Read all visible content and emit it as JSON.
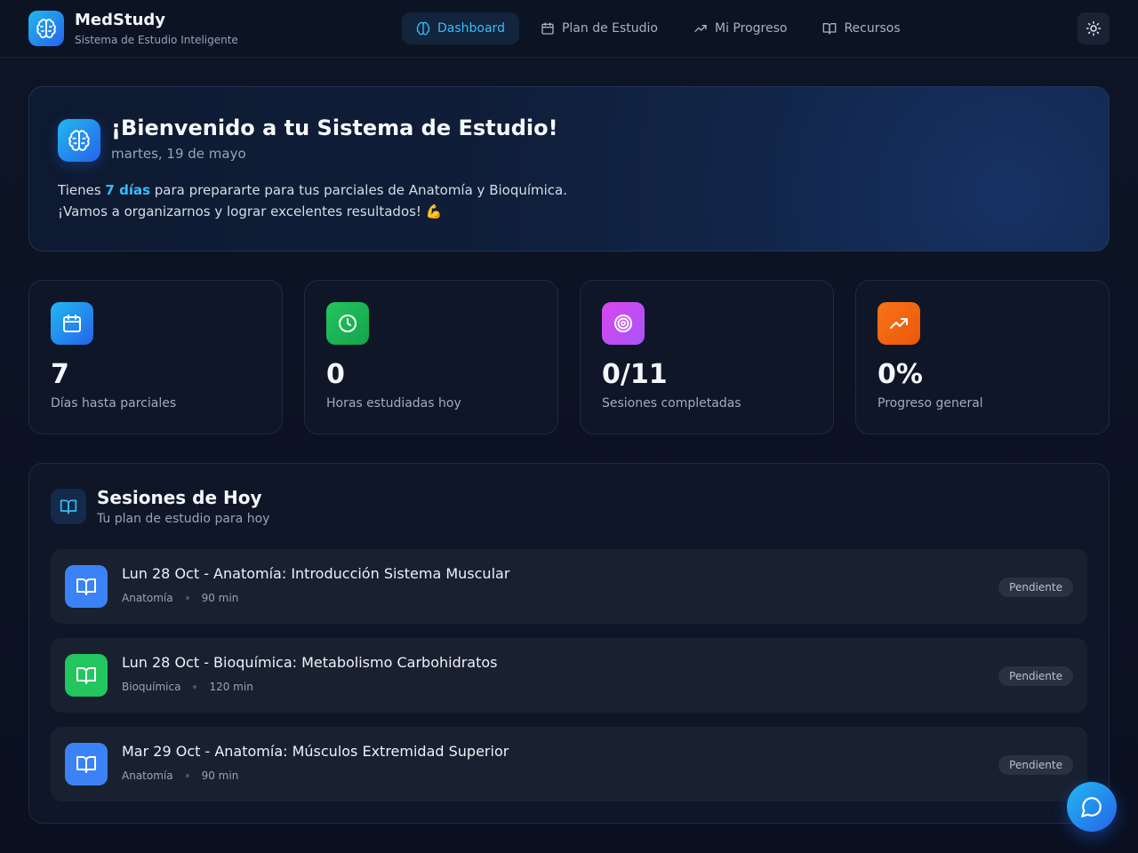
{
  "app": {
    "name": "MedStudy",
    "subtitle": "Sistema de Estudio Inteligente",
    "logo_icon": "brain-icon"
  },
  "nav": {
    "items": [
      {
        "label": "Dashboard",
        "icon": "brain-icon",
        "active": true
      },
      {
        "label": "Plan de Estudio",
        "icon": "calendar-icon",
        "active": false
      },
      {
        "label": "Mi Progreso",
        "icon": "trending-up-icon",
        "active": false
      },
      {
        "label": "Recursos",
        "icon": "book-open-icon",
        "active": false
      }
    ],
    "theme_toggle_icon": "sun-icon"
  },
  "welcome": {
    "title": "¡Bienvenido a tu Sistema de Estudio!",
    "date": "martes, 19 de mayo",
    "line1_prefix": "Tienes ",
    "line1_highlight": "7 días",
    "line1_suffix": " para prepararte para tus parciales de Anatomía y Bioquímica.",
    "line2": "¡Vamos a organizarnos y lograr excelentes resultados! 💪"
  },
  "stats": [
    {
      "value": "7",
      "label": "Días hasta parciales",
      "icon": "calendar-icon",
      "color_from": "#22b8f0",
      "color_to": "#2563eb"
    },
    {
      "value": "0",
      "label": "Horas estudiadas hoy",
      "icon": "clock-icon",
      "color_from": "#22c55e",
      "color_to": "#16a34a"
    },
    {
      "value": "0/11",
      "label": "Sesiones completadas",
      "icon": "target-icon",
      "color_from": "#d946ef",
      "color_to": "#a855f7"
    },
    {
      "value": "0%",
      "label": "Progreso general",
      "icon": "trending-up-icon",
      "color_from": "#f97316",
      "color_to": "#ea580c"
    }
  ],
  "sessions": {
    "title": "Sesiones de Hoy",
    "subtitle": "Tu plan de estudio para hoy",
    "items": [
      {
        "title": "Lun 28 Oct - Anatomía: Introducción Sistema Muscular",
        "subject": "Anatomía",
        "duration": "90 min",
        "status": "Pendiente",
        "color": "#3b82f6"
      },
      {
        "title": "Lun 28 Oct - Bioquímica: Metabolismo Carbohidratos",
        "subject": "Bioquímica",
        "duration": "120 min",
        "status": "Pendiente",
        "color": "#22c55e"
      },
      {
        "title": "Mar 29 Oct - Anatomía: Músculos Extremidad Superior",
        "subject": "Anatomía",
        "duration": "90 min",
        "status": "Pendiente",
        "color": "#3b82f6"
      }
    ]
  },
  "chat_button_icon": "chat-bubble-icon"
}
